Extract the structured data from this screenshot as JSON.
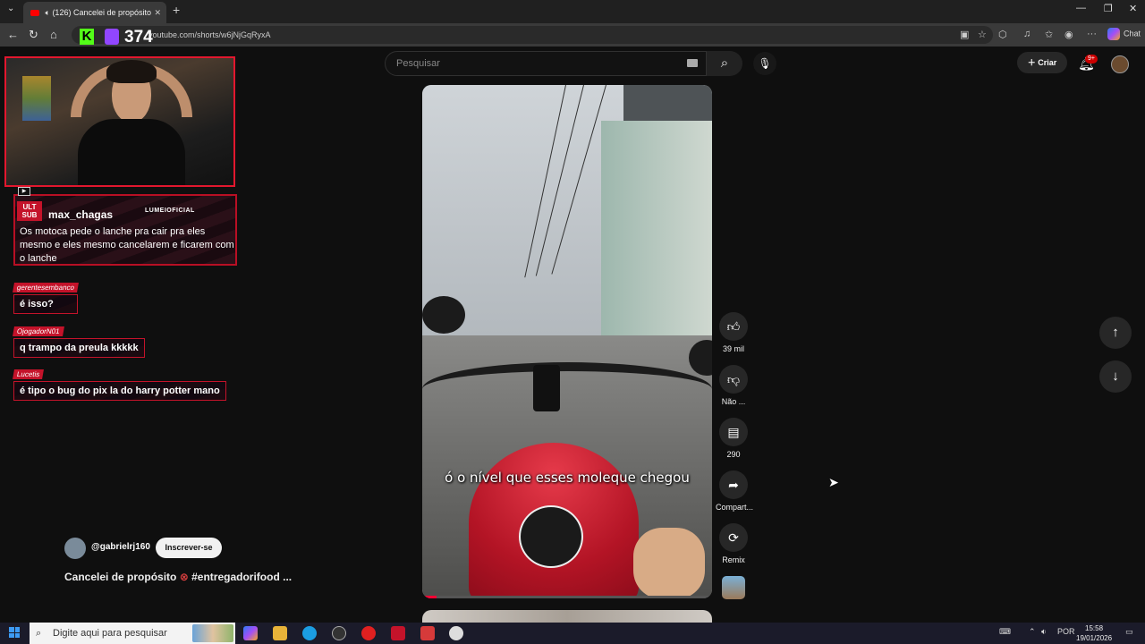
{
  "browser": {
    "tab_title": "(126) Cancelei de propósito",
    "url": "youtube.com/shorts/w6jNjGqRyxA",
    "chat_label": "Chat"
  },
  "stream_overlay": {
    "viewer_count": "374",
    "sub_alert": {
      "tag": "ULT SUB",
      "username": "max_chagas",
      "brand": "LUMEIOFICIAL",
      "message": "Os motoca pede o lanche pra cair pra eles mesmo e eles mesmo cancelarem e ficarem com o lanche"
    },
    "chat": [
      {
        "user": "gerentesembanco",
        "text": "é isso?"
      },
      {
        "user": "OjogadorN01",
        "text": "q trampo da preula kkkkk"
      },
      {
        "user": "Lucetis",
        "text": "é tipo o bug do pix la do harry potter mano"
      }
    ]
  },
  "youtube": {
    "search_placeholder": "Pesquisar",
    "create_label": "Criar",
    "notifications_badge": "9+",
    "short": {
      "channel": "@gabrielrj160",
      "subscribe_label": "Inscrever-se",
      "title": "Cancelei de propósito",
      "title_hashtag": "#entregadorifood ...",
      "caption": "ó o nível que esses moleque chegou",
      "progress": 0.05
    },
    "actions": {
      "likes": "39 mil",
      "dislike_label": "Não ...",
      "comments": "290",
      "share_label": "Compart...",
      "remix_label": "Remix"
    }
  },
  "taskbar": {
    "search_placeholder": "Digite aqui para pesquisar",
    "language": "POR",
    "time": "15:58",
    "date": "19/01/2026"
  },
  "colors": {
    "accent_red": "#c4132a",
    "youtube_red": "#ff0033",
    "kick_green": "#53fc18",
    "twitch_purple": "#9146ff"
  }
}
